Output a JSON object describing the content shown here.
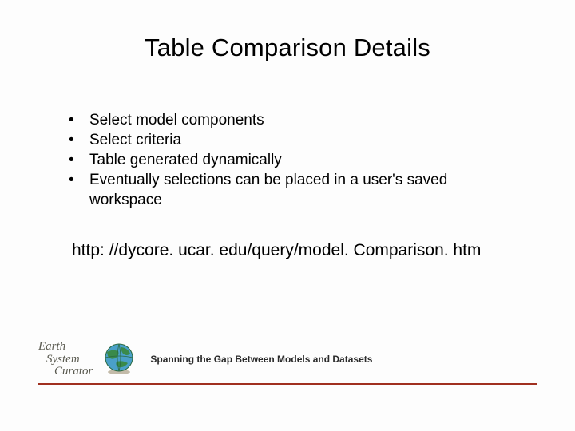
{
  "title": "Table Comparison Details",
  "bullets": [
    "Select model components",
    "Select criteria",
    "Table generated dynamically",
    "Eventually selections can be placed in a user's saved workspace"
  ],
  "url": "http: //dycore. ucar. edu/query/model. Comparison. htm",
  "footer": {
    "logo_lines": [
      "Earth",
      "System",
      "Curator"
    ],
    "tagline": "Spanning the Gap Between Models and Datasets"
  }
}
